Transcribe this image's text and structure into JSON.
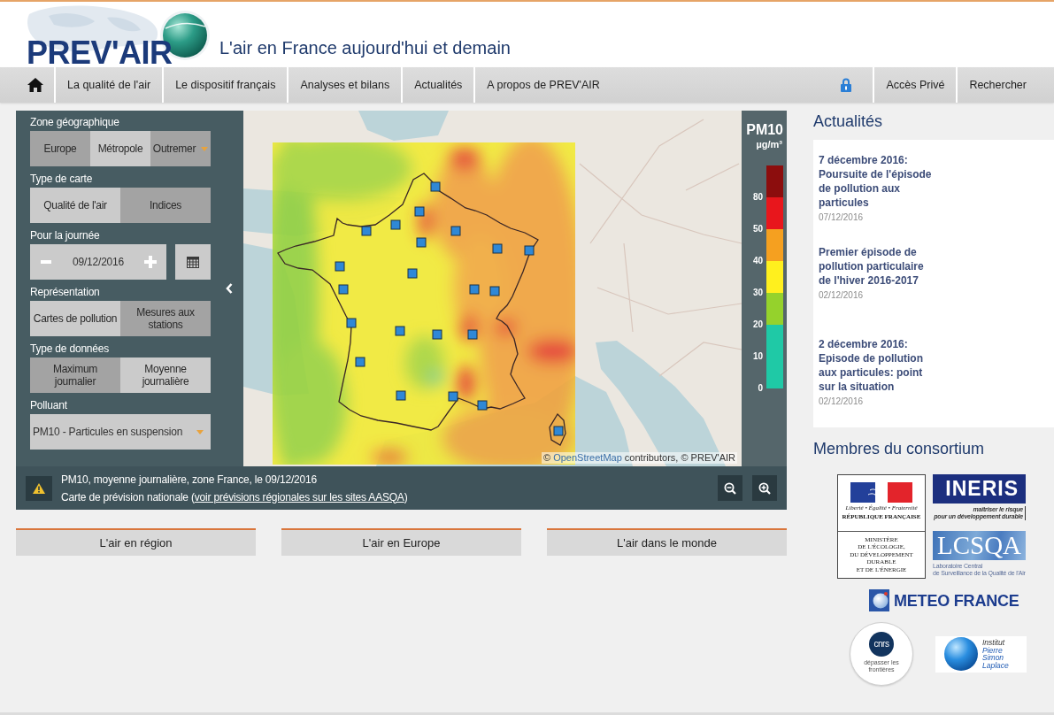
{
  "header": {
    "logo_text": "PREV'AIR",
    "tagline": "L'air en France aujourd'hui et demain"
  },
  "nav": {
    "items": [
      "La qualité de l'air",
      "Le dispositif français",
      "Analyses et bilans",
      "Actualités",
      "A propos de PREV'AIR"
    ],
    "right_items": [
      "Accès Privé",
      "Rechercher"
    ]
  },
  "map_panel": {
    "sections": [
      {
        "kind": "segmented",
        "label": "Zone géographique",
        "options": [
          {
            "kind": "option",
            "label": "Europe",
            "selected": false
          },
          {
            "kind": "option",
            "label": "Métropole",
            "selected": true
          },
          {
            "kind": "dropdown",
            "label": "Outremer",
            "selected": false
          }
        ]
      },
      {
        "kind": "segmented",
        "label": "Type de carte",
        "options": [
          {
            "kind": "option",
            "label": "Qualité de l'air",
            "selected": true
          },
          {
            "kind": "option",
            "label": "Indices",
            "selected": false
          }
        ]
      },
      {
        "kind": "date",
        "label": "Pour la journée",
        "value": "09/12/2016"
      },
      {
        "kind": "segmented",
        "label": "Représentation",
        "options": [
          {
            "kind": "option",
            "label": "Cartes de pollution",
            "selected": true
          },
          {
            "kind": "option",
            "label": "Mesures aux stations",
            "selected": false
          }
        ]
      },
      {
        "kind": "segmented",
        "label": "Type de données",
        "options": [
          {
            "kind": "option",
            "label": "Maximum journalier",
            "selected": false
          },
          {
            "kind": "option",
            "label": "Moyenne journalière",
            "selected": true
          }
        ]
      },
      {
        "kind": "select",
        "label": "Polluant",
        "value": "PM10 - Particules en suspension"
      }
    ],
    "legend": {
      "title": "PM10",
      "unit": "µg/m³",
      "classes": [
        {
          "color": "#8c0d0d",
          "label": "80"
        },
        {
          "color": "#e8161c",
          "label": "50"
        },
        {
          "color": "#f5a020",
          "label": "40"
        },
        {
          "color": "#fff01e",
          "label": "30"
        },
        {
          "color": "#95d22c",
          "label": "20"
        },
        {
          "color": "#1fc9a6",
          "label": "10"
        },
        {
          "color": "#1fc9a6",
          "label": "0"
        }
      ]
    },
    "attribution": {
      "prefix": "©",
      "link": "OpenStreetMap",
      "suffix": "contributors, © PREV'AIR"
    },
    "caption": {
      "line_1": "PM10, moyenne journalière, zone France, le 09/12/2016",
      "line_2": {
        "before": "Carte de prévision nationale (",
        "link": "voir prévisions régionales sur les sites AASQA",
        "after": ")"
      }
    }
  },
  "region_links": [
    "L'air en région",
    "L'air en Europe",
    "L'air dans le monde"
  ],
  "news": {
    "title": "Actualités",
    "items": [
      {
        "title": "7 décembre 2016: Poursuite de l'épisode de pollution aux particules",
        "date": "07/12/2016"
      },
      {
        "title": "Premier épisode de pollution particulaire de l'hiver 2016-2017",
        "date": "02/12/2016"
      },
      {
        "title": "2 décembre 2016: Episode de pollution aux particules: point sur la situation",
        "date": "02/12/2016"
      }
    ]
  },
  "consortium": {
    "title": "Membres du consortium",
    "logos": [
      {
        "kind": "ministry",
        "motto": "Liberté • Égalité • Fraternité",
        "name": "RÉPUBLIQUE FRANÇAISE",
        "lines": [
          "MINISTÈRE",
          "DE L'ÉCOLOGIE,",
          "DU DÉVELOPPEMENT",
          "DURABLE",
          "ET DE L'ÉNERGIE"
        ]
      },
      {
        "kind": "ineris",
        "name": "INERIS",
        "lines": [
          "maîtriser le risque",
          "pour un développement durable"
        ]
      },
      {
        "kind": "lcsqa",
        "name": "LCSQA",
        "lines": [
          "Laboratoire Central",
          "de Surveillance de la Qualité de l'Air"
        ]
      },
      {
        "kind": "meteo",
        "name": "METEO FRANCE"
      },
      {
        "kind": "cnrs",
        "name": "cnrs",
        "lines": [
          "dépasser les frontières"
        ]
      },
      {
        "kind": "ipsl",
        "lines": [
          "Institut",
          "Pierre",
          "Simon",
          "Laplace"
        ]
      }
    ]
  }
}
